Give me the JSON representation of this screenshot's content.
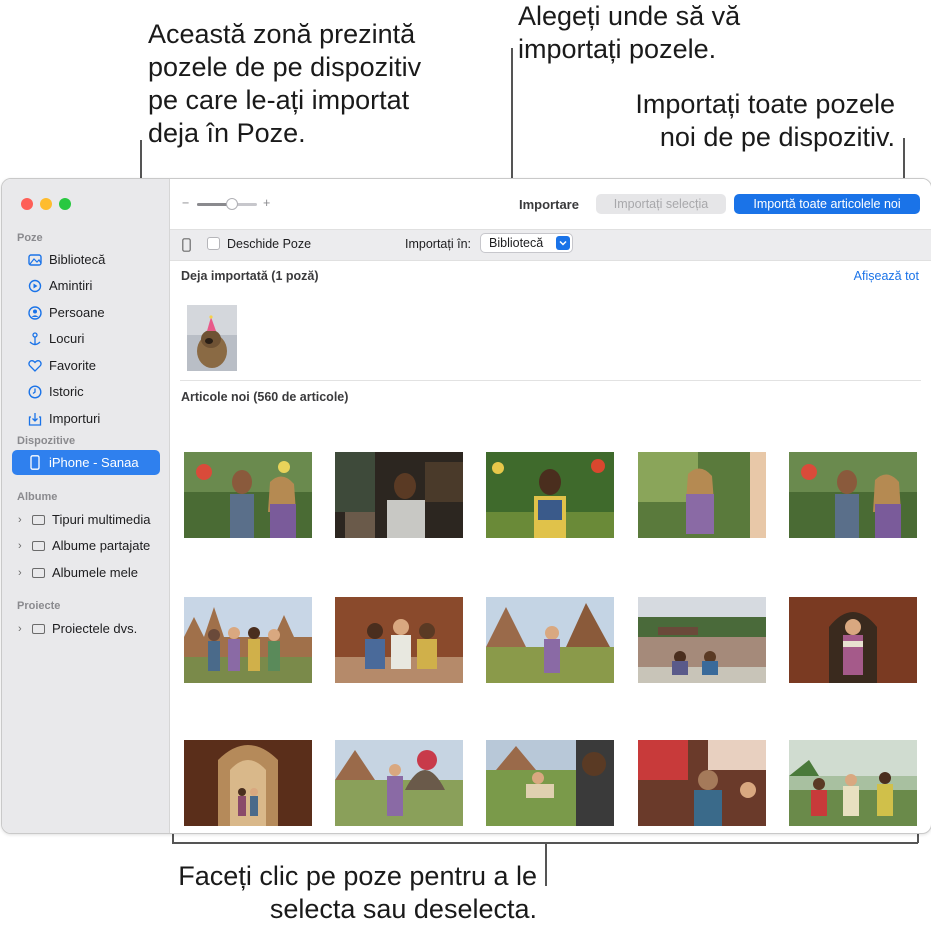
{
  "callouts": {
    "left": [
      "Această zonă prezintă",
      "pozele de pe dispozitiv",
      "pe care le-ați importat",
      "deja în Poze."
    ],
    "top": [
      "Alegeți unde să vă",
      "importați pozele."
    ],
    "right": [
      "Importați toate pozele",
      "noi de pe dispozitiv."
    ],
    "bottom": [
      "Faceți clic pe poze pentru a le",
      "selecta sau deselecta."
    ]
  },
  "sidebar": {
    "sections": {
      "photos": "Poze",
      "devices": "Dispozitive",
      "albums": "Albume",
      "projects": "Proiecte"
    },
    "photos_items": [
      {
        "label": "Bibliotecă",
        "icon": "library-icon"
      },
      {
        "label": "Amintiri",
        "icon": "memories-icon"
      },
      {
        "label": "Persoane",
        "icon": "people-icon"
      },
      {
        "label": "Locuri",
        "icon": "places-icon"
      },
      {
        "label": "Favorite",
        "icon": "heart-icon"
      },
      {
        "label": "Istoric",
        "icon": "clock-icon"
      },
      {
        "label": "Importuri",
        "icon": "import-icon"
      }
    ],
    "device_item": {
      "label": "iPhone - Sanaa",
      "icon": "iphone-icon"
    },
    "album_items": [
      {
        "label": "Tipuri multimedia"
      },
      {
        "label": "Albume partajate"
      },
      {
        "label": "Albumele mele"
      }
    ],
    "project_items": [
      {
        "label": "Proiectele dvs."
      }
    ]
  },
  "toolbar": {
    "zoom_minus": "−",
    "zoom_plus": "+",
    "zoom_level": 0.6,
    "title": "Importare",
    "import_selection": "Importați selecția",
    "import_all": "Importă toate articolele noi"
  },
  "subbar": {
    "open_photos_label": "Deschide Poze",
    "import_to_label": "Importați în:",
    "import_to_value": "Bibliotecă"
  },
  "already_imported": {
    "heading": "Deja importată (1 poză)",
    "show_all": "Afișează tot"
  },
  "new_items": {
    "heading": "Articole noi (560 de articole)"
  },
  "colors": {
    "accent": "#1a73e8",
    "sidebar_selected": "#2f80ee",
    "close": "#fe5f57",
    "minimize": "#febc2e",
    "zoom": "#28c840"
  }
}
